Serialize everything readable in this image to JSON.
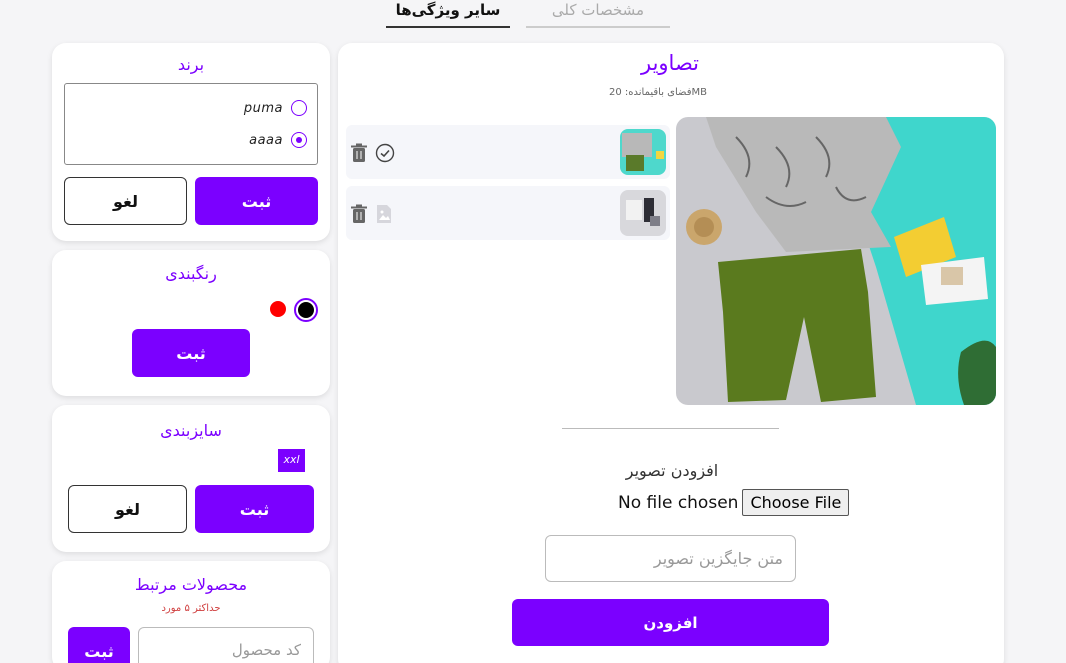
{
  "tabs": {
    "active": "سایر ویژگی‌ها",
    "inactive": "مشخصات کلی"
  },
  "brand_card": {
    "title": "برند",
    "options": [
      {
        "label": "puma",
        "checked": false
      },
      {
        "label": "aaaa",
        "checked": true
      }
    ],
    "submit_label": "ثبت",
    "cancel_label": "لغو"
  },
  "colors_card": {
    "title": "رنگبندی",
    "swatches": [
      {
        "color": "#000000",
        "selected": true
      },
      {
        "color": "#ff0000",
        "selected": false
      }
    ],
    "submit_label": "ثبت"
  },
  "sizes_card": {
    "title": "سایزبندی",
    "sizes": [
      "xxl"
    ],
    "submit_label": "ثبت",
    "cancel_label": "لغو"
  },
  "related_card": {
    "title": "محصولات مرتبط",
    "limit_note": "حداکثر ۵ مورد",
    "input_placeholder": "کد محصول",
    "submit_label": "ثبت"
  },
  "images_panel": {
    "title": "تصاویر",
    "space_remaining": "فضای باقیمانده: 20MB",
    "add_image_label": "افزودن تصویر",
    "file_status": "No file chosen",
    "choose_file_label": "Choose File",
    "alt_text_placeholder": "متن جایگزین تصویر",
    "add_button_label": "افزودن",
    "items": [
      {
        "row_icon": "check-circle-icon",
        "action_icon": "trash-icon"
      },
      {
        "row_icon": "image-placeholder-icon",
        "action_icon": "trash-icon"
      }
    ]
  },
  "colors": {
    "accent": "#7b00ff",
    "title_text": "#7b00ff",
    "note_red": "#d04040"
  }
}
